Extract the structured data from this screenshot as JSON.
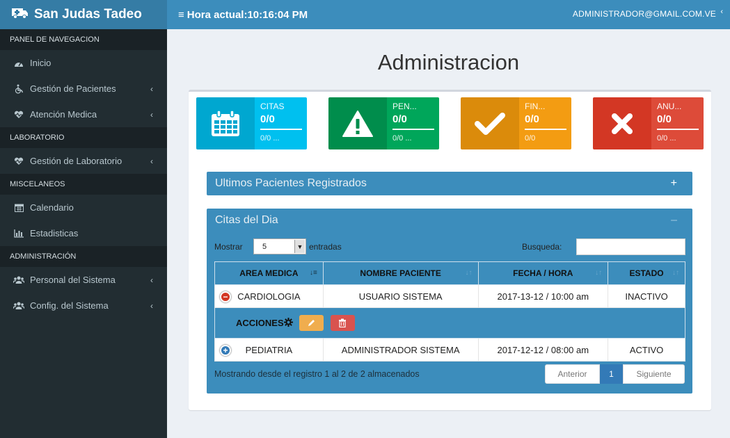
{
  "brand": {
    "name": "San Judas Tadeo",
    "icon": "ambulance-icon"
  },
  "topbar": {
    "menu_icon": "bars-icon",
    "clock_label": "Hora actual:",
    "clock_time": "10:16:04 PM",
    "user": "ADMINISTRADOR@GMAIL.COM.VE"
  },
  "sidebar": {
    "sections": [
      {
        "header": "PANEL DE NAVEGACION",
        "items": [
          {
            "label": "Inicio",
            "icon": "dashboard-icon",
            "submenu": false
          },
          {
            "label": "Gestión de Pacientes",
            "icon": "wheelchair-icon",
            "submenu": true
          },
          {
            "label": "Atención Medica",
            "icon": "heartbeat-icon",
            "submenu": true
          }
        ]
      },
      {
        "header": "LABORATORIO",
        "items": [
          {
            "label": "Gestión de Laboratorio",
            "icon": "heartbeat-icon",
            "submenu": true
          }
        ]
      },
      {
        "header": "MISCELANEOS",
        "items": [
          {
            "label": "Calendario",
            "icon": "calendar-icon",
            "submenu": false
          },
          {
            "label": "Estadisticas",
            "icon": "bar-chart-icon",
            "submenu": false
          }
        ]
      },
      {
        "header": "ADMINISTRACIÓN",
        "items": [
          {
            "label": "Personal del Sistema",
            "icon": "users-icon",
            "submenu": true
          },
          {
            "label": "Config. del Sistema",
            "icon": "users-icon",
            "submenu": true
          }
        ]
      }
    ]
  },
  "main": {
    "title": "Administracion",
    "stats": [
      {
        "label": "CITAS",
        "value": "0/0",
        "desc": "0/0 ...",
        "icon": "calendar-icon",
        "color_icon": "#00a7d0",
        "color_body": "#00c0ef"
      },
      {
        "label": "PEN...",
        "value": "0/0",
        "desc": "0/0 ...",
        "icon": "warning-icon",
        "color_icon": "#008d4c",
        "color_body": "#00a65a"
      },
      {
        "label": "FIN...",
        "value": "0/0",
        "desc": "0/0",
        "icon": "check-icon",
        "color_icon": "#db8b0b",
        "color_body": "#f39c12"
      },
      {
        "label": "ANU...",
        "value": "0/0",
        "desc": "0/0 ...",
        "icon": "times-icon",
        "color_icon": "#d33724",
        "color_body": "#dd4b39"
      }
    ],
    "panel_recent": {
      "title": "Ultimos Pacientes Registrados",
      "tool": "+"
    },
    "panel_today": {
      "title": "Citas del Dia",
      "tool": "–"
    },
    "table_controls": {
      "show_label": "Mostrar",
      "page_size": "5",
      "entries_label": "entradas",
      "search_label": "Busqueda:",
      "search_value": ""
    },
    "table": {
      "columns": [
        "AREA MEDICA",
        "NOMBRE PACIENTE",
        "FECHA / HORA",
        "ESTADO"
      ],
      "rows": [
        {
          "area": "CARDIOLOGIA",
          "nombre": "USUARIO SISTEMA",
          "fecha": "2017-13-12 / 10:00 am",
          "estado": "INACTIVO",
          "expanded": true
        },
        {
          "area": "PEDIATRIA",
          "nombre": "ADMINISTRADOR SISTEMA",
          "fecha": "2017-12-12 / 08:00 am",
          "estado": "ACTIVO",
          "expanded": false
        }
      ],
      "detail_label": "ACCIONES"
    },
    "footer": {
      "info": "Mostrando desde el registro 1 al 2 de 2 almacenados",
      "prev": "Anterior",
      "page": "1",
      "next": "Siguiente"
    }
  }
}
